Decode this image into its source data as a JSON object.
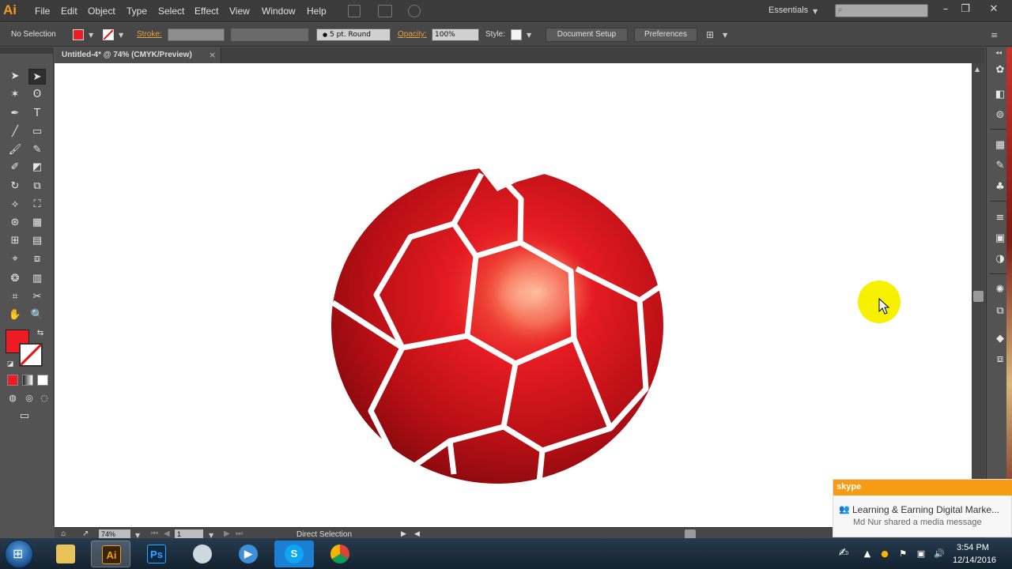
{
  "app": {
    "logo": "Ai"
  },
  "menu": [
    "File",
    "Edit",
    "Object",
    "Type",
    "Select",
    "Effect",
    "View",
    "Window",
    "Help"
  ],
  "workspace": {
    "label": "Essentials"
  },
  "control_bar": {
    "selection": "No Selection",
    "stroke_label": "Stroke:",
    "brush": "5 pt. Round",
    "opacity_label": "Opacity:",
    "opacity_value": "100%",
    "style_label": "Style:",
    "document_setup": "Document Setup",
    "preferences": "Preferences"
  },
  "document": {
    "tab_title": "Untitled-4* @ 74% (CMYK/Preview)",
    "close": "×"
  },
  "status": {
    "zoom": "74%",
    "page": "1",
    "tool": "Direct Selection"
  },
  "toast": {
    "brand": "skype",
    "title": "Learning & Earning Digital Marke...",
    "message": "Md Nur shared a media message"
  },
  "clock": {
    "time": "3:54 PM",
    "date": "12/14/2016"
  },
  "colors": {
    "fill": "#ec1c24",
    "artwork": "#c8131b",
    "cursor_highlight": "#f7f000",
    "toast_accent": "#f79b13"
  },
  "icons": {
    "window": [
      "minimize-icon",
      "restore-icon",
      "close-icon"
    ],
    "taskbar": [
      "windows-start-icon",
      "file-explorer-icon",
      "illustrator-icon",
      "photoshop-icon",
      "steam-icon",
      "media-player-icon",
      "skype-icon",
      "chrome-icon"
    ]
  }
}
